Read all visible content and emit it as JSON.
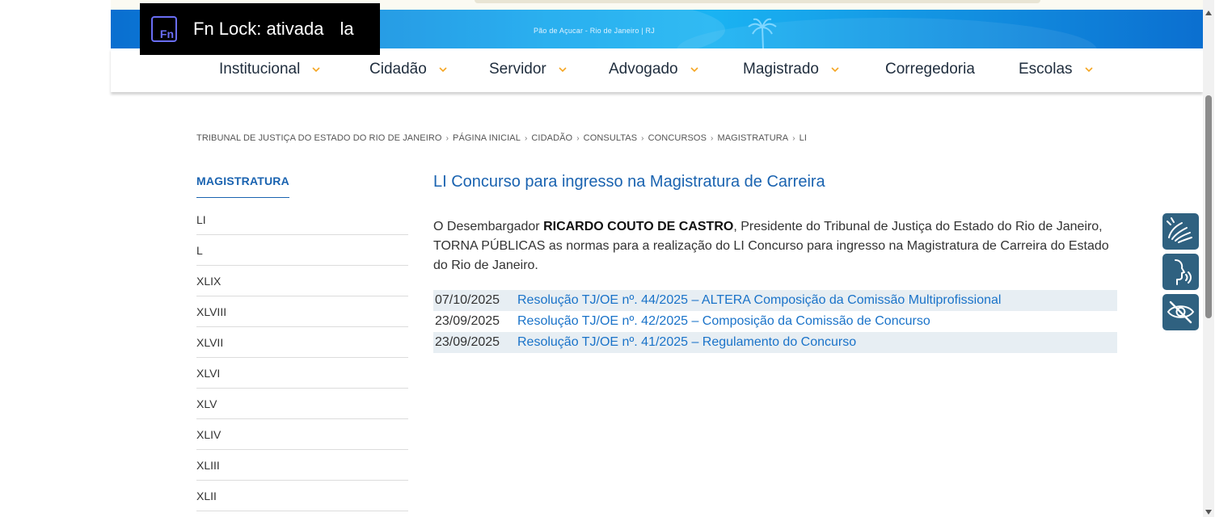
{
  "banner": {
    "caption": "Pão de Açucar - Rio de Janeiro | RJ"
  },
  "fn_lock": {
    "icon_label": "Fn",
    "text": "Fn Lock: ativada",
    "extra": "la"
  },
  "nav": {
    "items": [
      {
        "label": "Institucional",
        "dropdown": true
      },
      {
        "label": "Cidadão",
        "dropdown": true
      },
      {
        "label": "Servidor",
        "dropdown": true
      },
      {
        "label": "Advogado",
        "dropdown": true
      },
      {
        "label": "Magistrado",
        "dropdown": true
      },
      {
        "label": "Corregedoria",
        "dropdown": false
      },
      {
        "label": "Escolas",
        "dropdown": true
      }
    ],
    "accent_color": "#f5a623"
  },
  "breadcrumb": [
    "TRIBUNAL DE JUSTIÇA DO ESTADO DO RIO DE JANEIRO",
    "PÁGINA INICIAL",
    "CIDADÃO",
    "CONSULTAS",
    "CONCURSOS",
    "MAGISTRATURA",
    "LI"
  ],
  "sidebar": {
    "title": "MAGISTRATURA",
    "items": [
      "LI",
      "L",
      "XLIX",
      "XLVIII",
      "XLVII",
      "XLVI",
      "XLV",
      "XLIV",
      "XLIII",
      "XLII"
    ]
  },
  "main": {
    "title": "LI Concurso para ingresso na Magistratura de Carreira",
    "intro_before": "O Desembargador ",
    "intro_bold": "RICARDO COUTO DE CASTRO",
    "intro_after": ", Presidente do Tribunal de Justiça do Estado do Rio de Janeiro, TORNA PÚBLICAS as normas para a realização do LI Concurso para ingresso na Magistratura de Carreira do Estado do Rio de Janeiro.",
    "documents": [
      {
        "date": "07/10/2025",
        "title": "Resolução TJ/OE nº. 44/2025 – ALTERA Composição da Comissão Multiprofissional"
      },
      {
        "date": "23/09/2025",
        "title": "Resolução TJ/OE nº. 42/2025 – Composição da Comissão de Concurso"
      },
      {
        "date": "23/09/2025",
        "title": "Resolução TJ/OE nº. 41/2025 – Regulamento do Concurso"
      }
    ]
  },
  "accessibility": [
    "sign-language-icon",
    "speech-icon",
    "low-vision-icon"
  ],
  "colors": {
    "link": "#1a73c9",
    "title": "#1a63b0",
    "access_bg": "#2f6180",
    "row_bg": "#e7eef3"
  }
}
